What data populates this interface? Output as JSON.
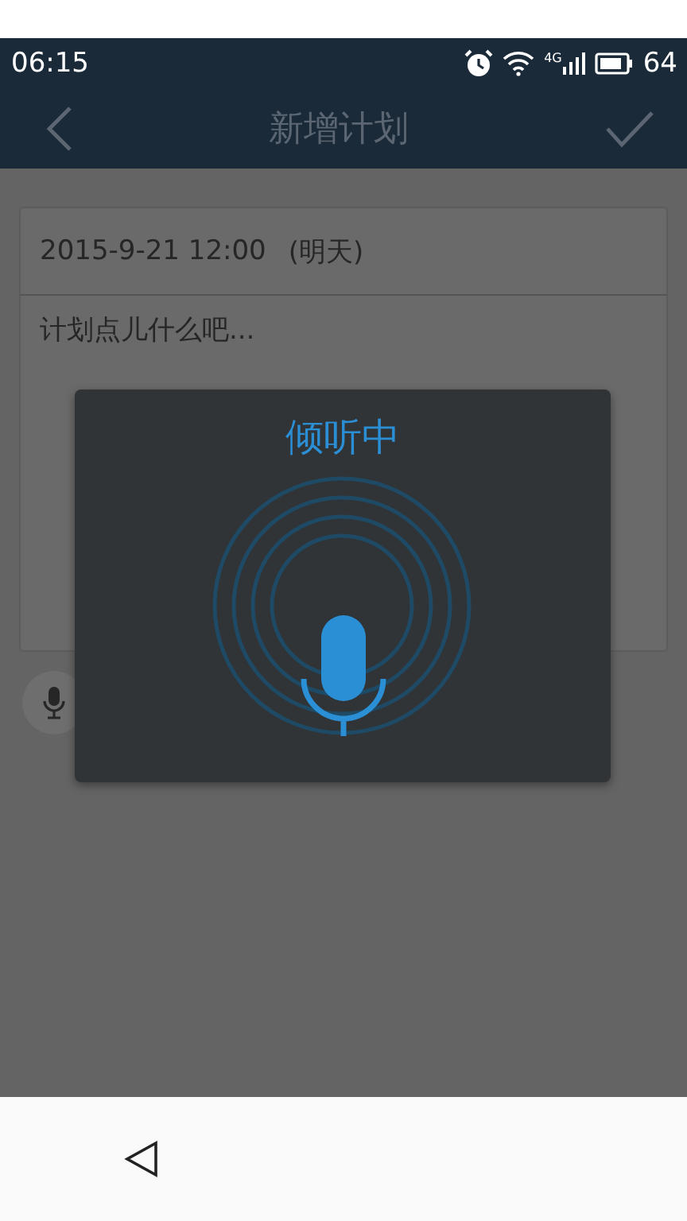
{
  "status_bar": {
    "time": "06:15",
    "network": "4G",
    "battery": "64"
  },
  "header": {
    "title": "新增计划"
  },
  "plan": {
    "date": "2015-9-21 12:00",
    "relative_day": "(明天)",
    "note": {
      "placeholder": "计划点儿什么吧..."
    }
  },
  "voice_dialog": {
    "title": "倾听中"
  }
}
